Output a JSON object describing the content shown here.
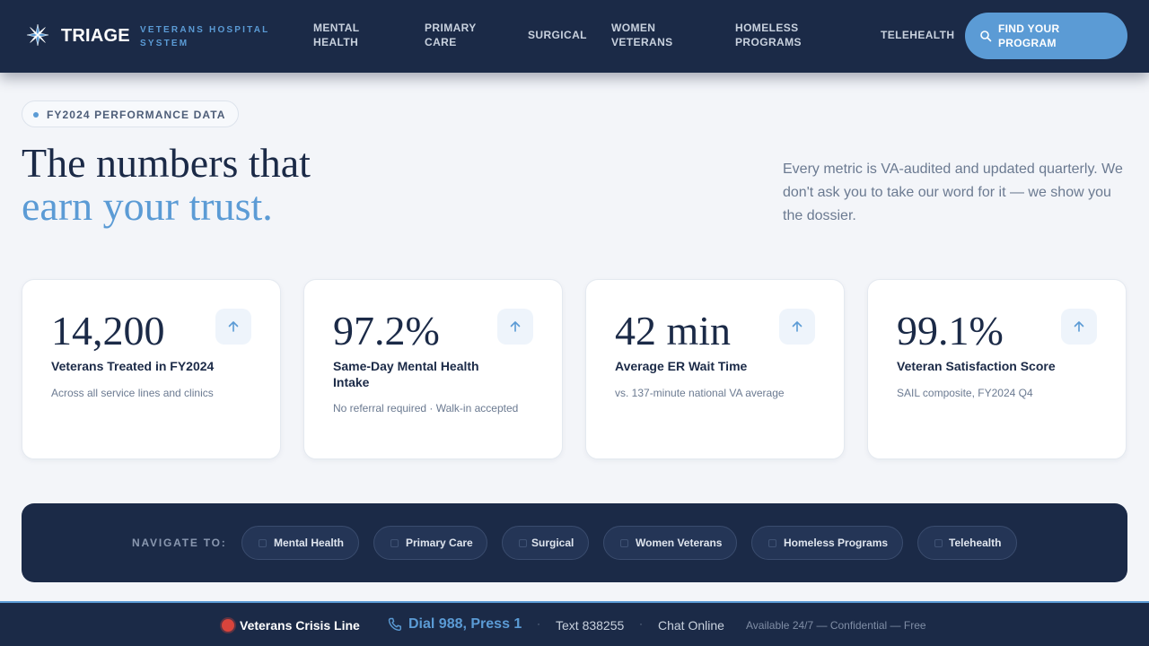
{
  "header": {
    "brand": "TRIAGE",
    "brand_sub": "VETERANS HOSPITAL SYSTEM",
    "nav": [
      {
        "label": "MENTAL HEALTH"
      },
      {
        "label": "PRIMARY CARE"
      },
      {
        "label": "SURGICAL"
      },
      {
        "label": "WOMEN VETERANS"
      },
      {
        "label": "HOMELESS PROGRAMS"
      },
      {
        "label": "TELEHEALTH"
      }
    ],
    "cta_label": "FIND YOUR PROGRAM",
    "cta_icon": "search-icon"
  },
  "hero": {
    "pill": "FY2024 PERFORMANCE DATA",
    "title_line1": "The numbers that",
    "title_line2": "earn your trust.",
    "description": "Every metric is VA-audited and updated quarterly. We don't ask you to take our word for it — we show you the dossier."
  },
  "stats": [
    {
      "value": "14,200",
      "label": "Veterans Treated in FY2024",
      "note": "Across all service lines and clinics",
      "icon": "arrow-up-icon"
    },
    {
      "value": "97.2%",
      "label": "Same-Day Mental Health Intake",
      "note": "No referral required · Walk-in accepted",
      "icon": "arrow-up-icon"
    },
    {
      "value": "42 min",
      "label": "Average ER Wait Time",
      "note": "vs. 137-minute national VA average",
      "icon": "arrow-up-icon"
    },
    {
      "value": "99.1%",
      "label": "Veteran Satisfaction Score",
      "note": "SAIL composite, FY2024 Q4",
      "icon": "arrow-up-icon"
    }
  ],
  "navigate": {
    "label": "NAVIGATE TO:",
    "chips": [
      {
        "label": "Mental Health"
      },
      {
        "label": "Primary Care"
      },
      {
        "label": "Surgical"
      },
      {
        "label": "Women Veterans"
      },
      {
        "label": "Homeless Programs"
      },
      {
        "label": "Telehealth"
      }
    ]
  },
  "crisis": {
    "title": "Veterans Crisis Line",
    "dial": "Dial 988, Press 1",
    "sep": "·",
    "text": "Text 838255",
    "chat": "Chat Online",
    "availability": "Available 24/7 — Confidential — Free"
  },
  "colors": {
    "navy": "#1b2a47",
    "accent": "#5b9bd5",
    "background": "#f3f5f9",
    "alert": "#d9443c"
  }
}
